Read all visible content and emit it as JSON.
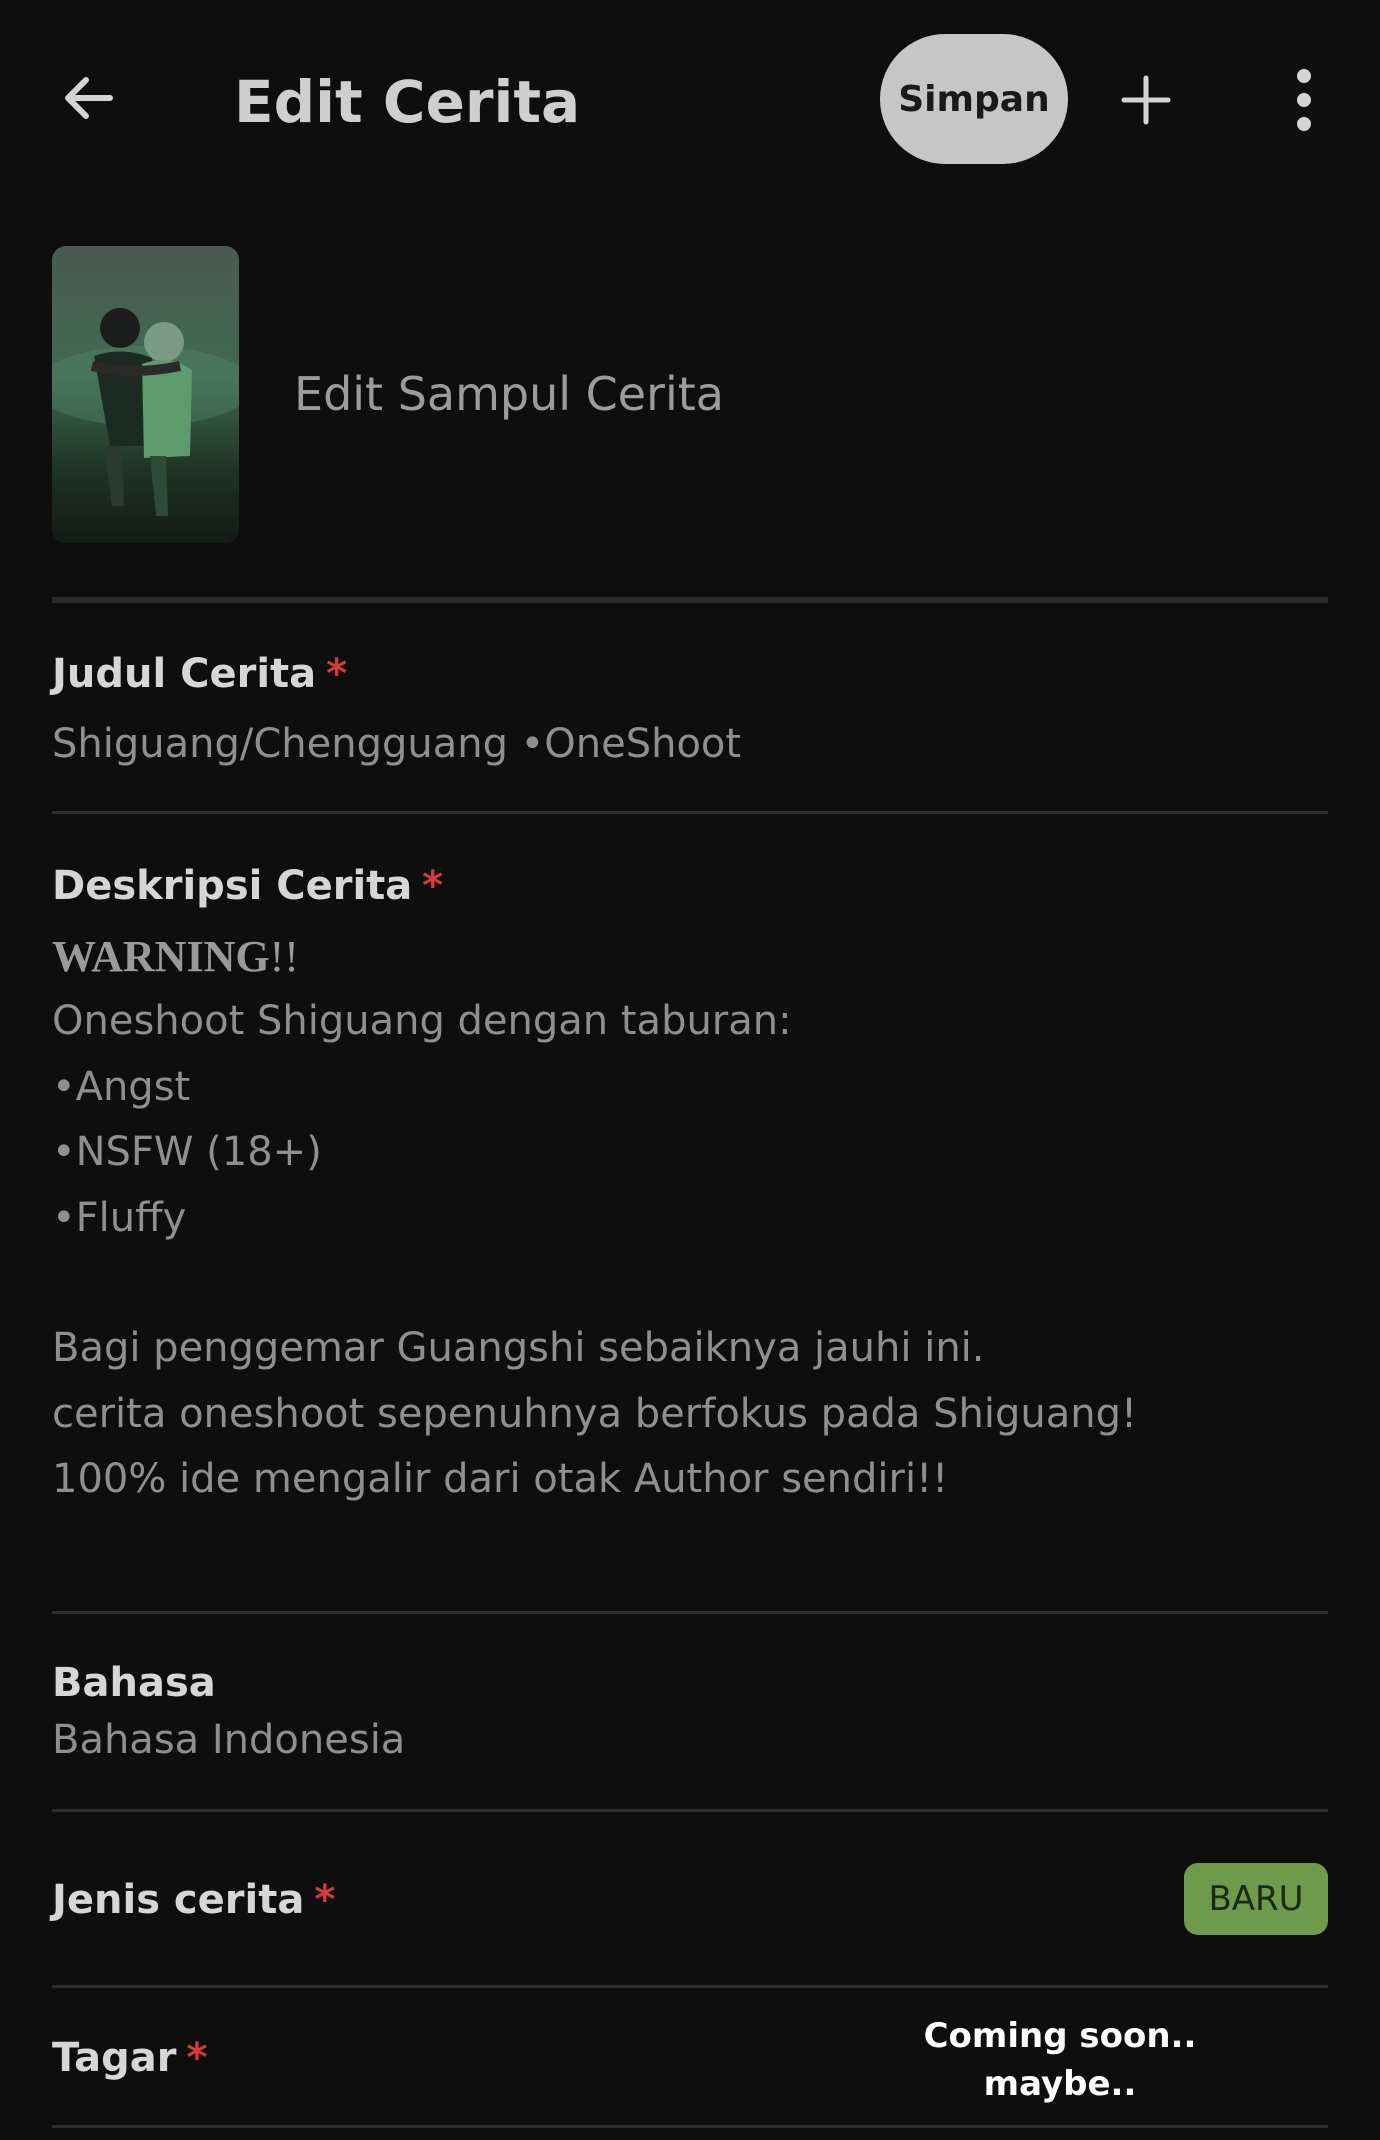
{
  "header": {
    "title": "Edit Cerita",
    "save_label": "Simpan",
    "back_icon": "arrow-left-icon",
    "add_icon": "plus-icon",
    "more_icon": "more-vertical-icon"
  },
  "cover": {
    "label": "Edit Sampul Cerita"
  },
  "title_field": {
    "label": "Judul Cerita",
    "required_mark": "*",
    "value": "Shiguang/Chengguang •OneShoot"
  },
  "description_field": {
    "label": "Deskripsi Cerita",
    "required_mark": "*",
    "warning_bold": "WARNING",
    "warning_tail": "!!",
    "lines": [
      "Oneshoot Shiguang dengan taburan:",
      "•Angst",
      "•NSFW (18+)",
      "•Fluffy",
      "",
      "Bagi penggemar Guangshi sebaiknya jauhi ini.",
      "cerita oneshoot sepenuhnya berfokus pada Shiguang!",
      "100% ide mengalir dari otak Author sendiri!!"
    ]
  },
  "language_field": {
    "label": "Bahasa",
    "value": "Bahasa Indonesia"
  },
  "type_field": {
    "label": "Jenis cerita",
    "required_mark": "*",
    "badge": "BARU",
    "badge_color": "#6f9a4c"
  },
  "tags_field": {
    "label": "Tagar",
    "required_mark": "*"
  },
  "overlay": {
    "line1": "Coming soon..",
    "line2": "maybe.."
  },
  "colors": {
    "background": "#0e0e0f",
    "required": "#d23c3c",
    "save_button": "#c6c6c6"
  }
}
